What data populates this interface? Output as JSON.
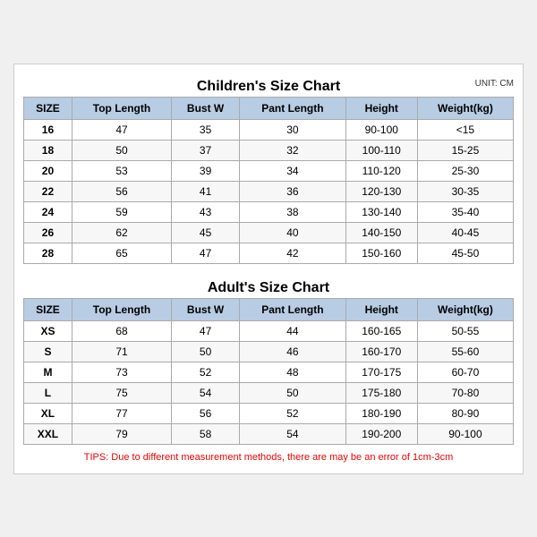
{
  "children_section": {
    "title": "Children's Size Chart",
    "unit": "UNIT: CM",
    "headers": [
      "SIZE",
      "Top Length",
      "Bust W",
      "Pant Length",
      "Height",
      "Weight(kg)"
    ],
    "rows": [
      [
        "16",
        "47",
        "35",
        "30",
        "90-100",
        "<15"
      ],
      [
        "18",
        "50",
        "37",
        "32",
        "100-110",
        "15-25"
      ],
      [
        "20",
        "53",
        "39",
        "34",
        "110-120",
        "25-30"
      ],
      [
        "22",
        "56",
        "41",
        "36",
        "120-130",
        "30-35"
      ],
      [
        "24",
        "59",
        "43",
        "38",
        "130-140",
        "35-40"
      ],
      [
        "26",
        "62",
        "45",
        "40",
        "140-150",
        "40-45"
      ],
      [
        "28",
        "65",
        "47",
        "42",
        "150-160",
        "45-50"
      ]
    ]
  },
  "adults_section": {
    "title": "Adult's Size Chart",
    "headers": [
      "SIZE",
      "Top Length",
      "Bust W",
      "Pant Length",
      "Height",
      "Weight(kg)"
    ],
    "rows": [
      [
        "XS",
        "68",
        "47",
        "44",
        "160-165",
        "50-55"
      ],
      [
        "S",
        "71",
        "50",
        "46",
        "160-170",
        "55-60"
      ],
      [
        "M",
        "73",
        "52",
        "48",
        "170-175",
        "60-70"
      ],
      [
        "L",
        "75",
        "54",
        "50",
        "175-180",
        "70-80"
      ],
      [
        "XL",
        "77",
        "56",
        "52",
        "180-190",
        "80-90"
      ],
      [
        "XXL",
        "79",
        "58",
        "54",
        "190-200",
        "90-100"
      ]
    ]
  },
  "tips": "TIPS: Due to different measurement methods, there are may be an error of 1cm-3cm"
}
